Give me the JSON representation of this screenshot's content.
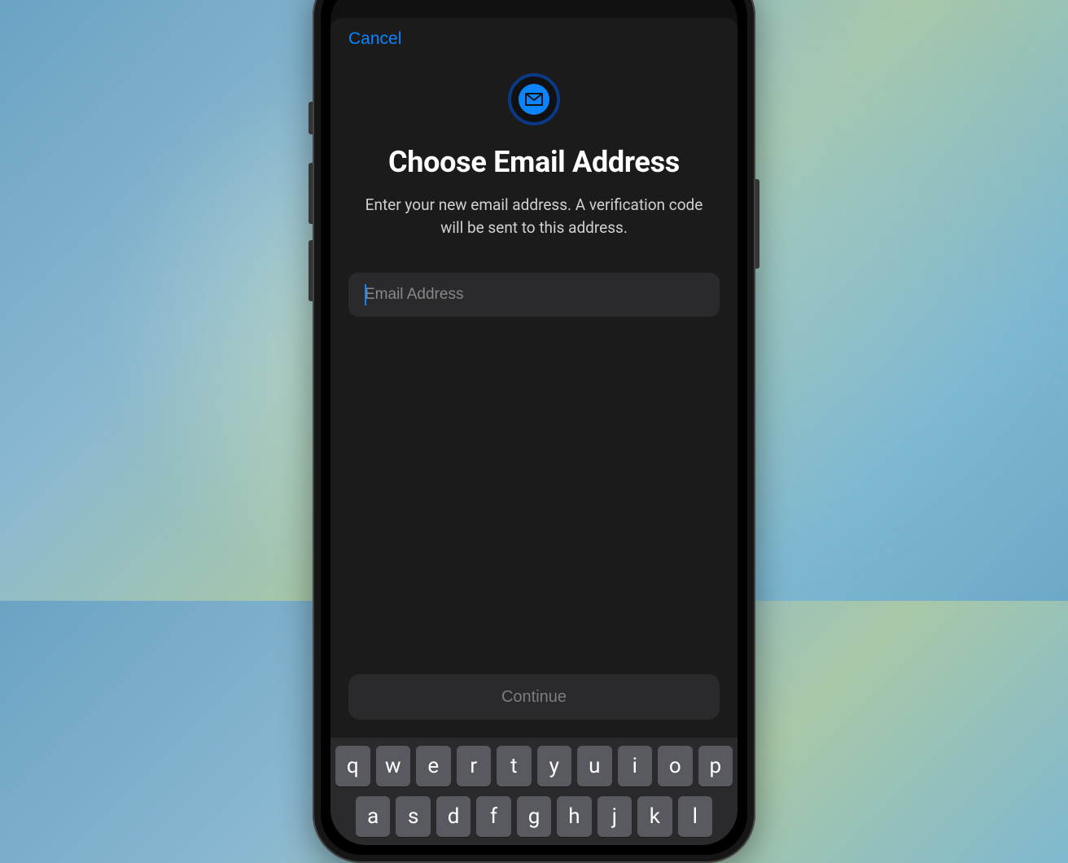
{
  "nav": {
    "cancel_label": "Cancel"
  },
  "hero": {
    "icon_name": "mail-icon",
    "title": "Choose Email Address",
    "subtitle": "Enter your new email address. A verification code will be sent to this address."
  },
  "form": {
    "email_placeholder": "Email Address",
    "email_value": "",
    "continue_label": "Continue"
  },
  "keyboard": {
    "row1": [
      "q",
      "w",
      "e",
      "r",
      "t",
      "y",
      "u",
      "i",
      "o",
      "p"
    ],
    "row2": [
      "a",
      "s",
      "d",
      "f",
      "g",
      "h",
      "j",
      "k",
      "l"
    ]
  },
  "colors": {
    "accent": "#0a84ff",
    "field_bg": "#2a2a2c",
    "sheet_bg": "#1b1b1b"
  }
}
